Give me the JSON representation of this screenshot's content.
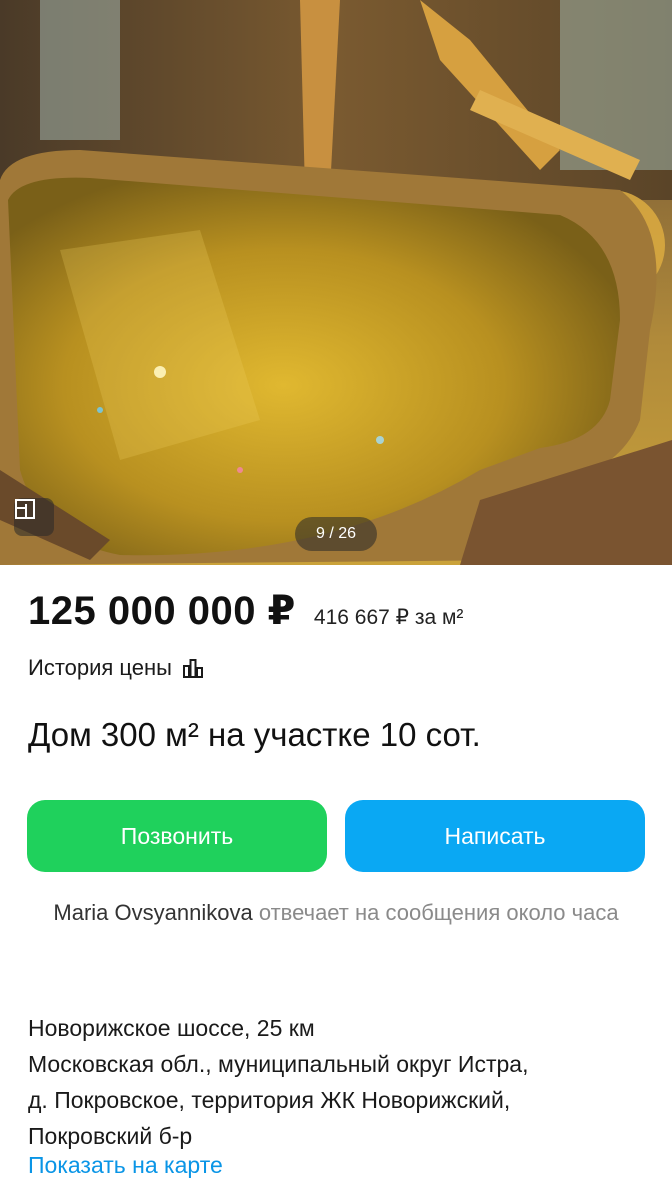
{
  "gallery": {
    "counter": "9 / 26",
    "plan_icon": "floor-plan-icon"
  },
  "listing": {
    "price": "125 000 000 ₽",
    "price_per_m2": "416 667 ₽ за м²",
    "price_history_label": "История цены",
    "price_history_icon": "bar-chart-icon",
    "title": "Дом 300 м² на участке 10 сот."
  },
  "actions": {
    "call_label": "Позвонить",
    "write_label": "Написать",
    "call_color": "#1fd15c",
    "write_color": "#0aa8f3"
  },
  "seller": {
    "name": "Maria Ovsyannikova",
    "response_text": "отвечает на сообщения около часа"
  },
  "location": {
    "highway": "Новорижское шоссе, 25 км",
    "address_line1": "Московская обл., муниципальный округ Истра,",
    "address_line2": "д. Покровское, территория ЖК Новорижский,",
    "address_line3": "Покровский б-р",
    "map_link": "Показать на карте"
  }
}
